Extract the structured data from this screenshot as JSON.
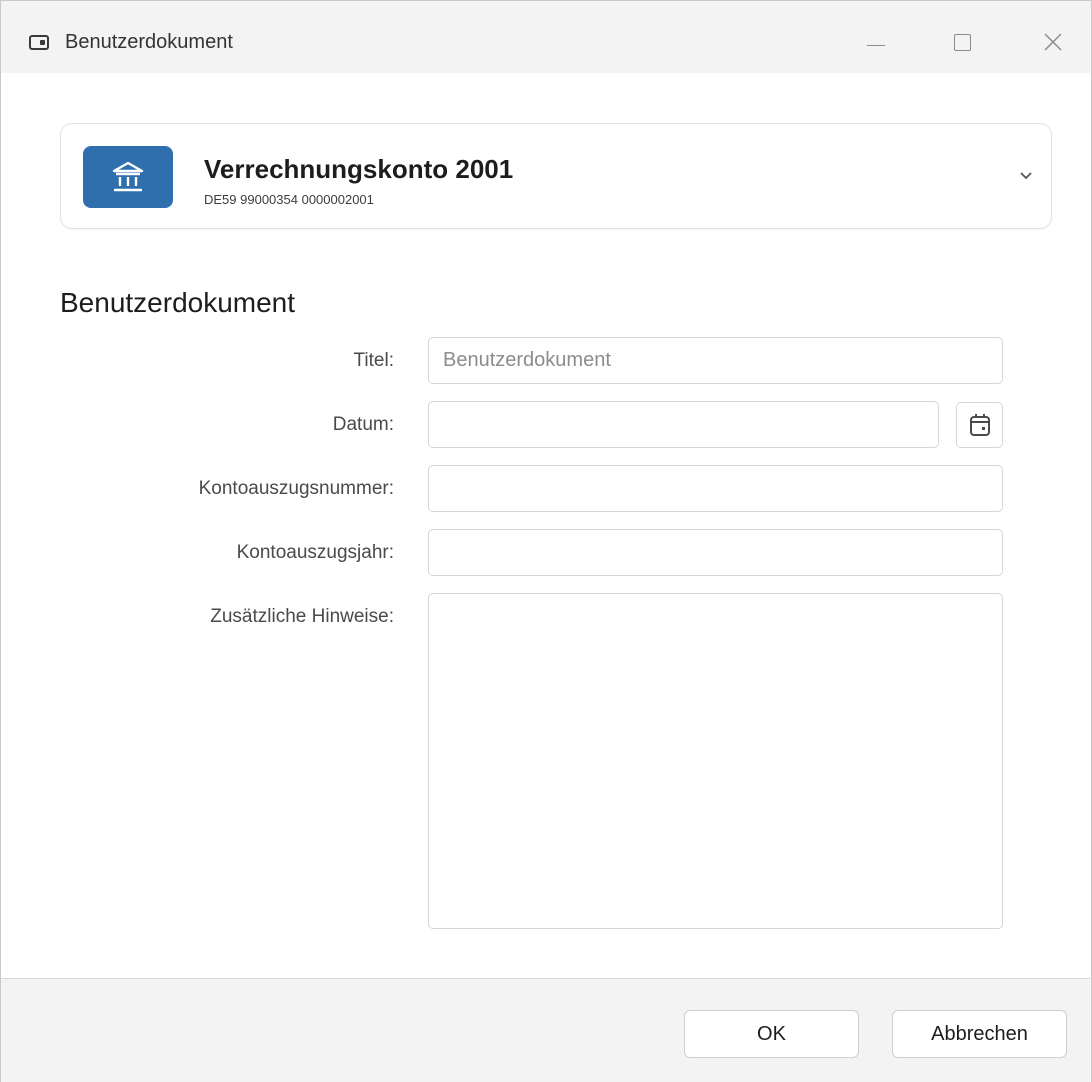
{
  "window": {
    "title": "Benutzerdokument",
    "icon": "app-window-icon",
    "controls": [
      "minimize-icon",
      "maximize-icon",
      "close-icon"
    ]
  },
  "account": {
    "name": "Verrechnungskonto 2001",
    "iban": "DE59 99000354 0000002001",
    "icon": "bank-icon",
    "icon_color": "#2f6fae",
    "dropdown_icon": "chevron-down-icon"
  },
  "section": {
    "title": "Benutzerdokument"
  },
  "form": {
    "titel": {
      "label": "Titel:",
      "value": "",
      "placeholder": "Benutzerdokument"
    },
    "datum": {
      "label": "Datum:",
      "value": "",
      "calendar_icon": "calendar-icon"
    },
    "kontoauszugsnummer": {
      "label": "Kontoauszugsnummer:",
      "value": ""
    },
    "kontoauszugsjahr": {
      "label": "Kontoauszugsjahr:",
      "value": ""
    },
    "hinweise": {
      "label": "Zusätzliche Hinweise:",
      "value": ""
    }
  },
  "footer": {
    "ok_label": "OK",
    "cancel_label": "Abbrechen"
  }
}
